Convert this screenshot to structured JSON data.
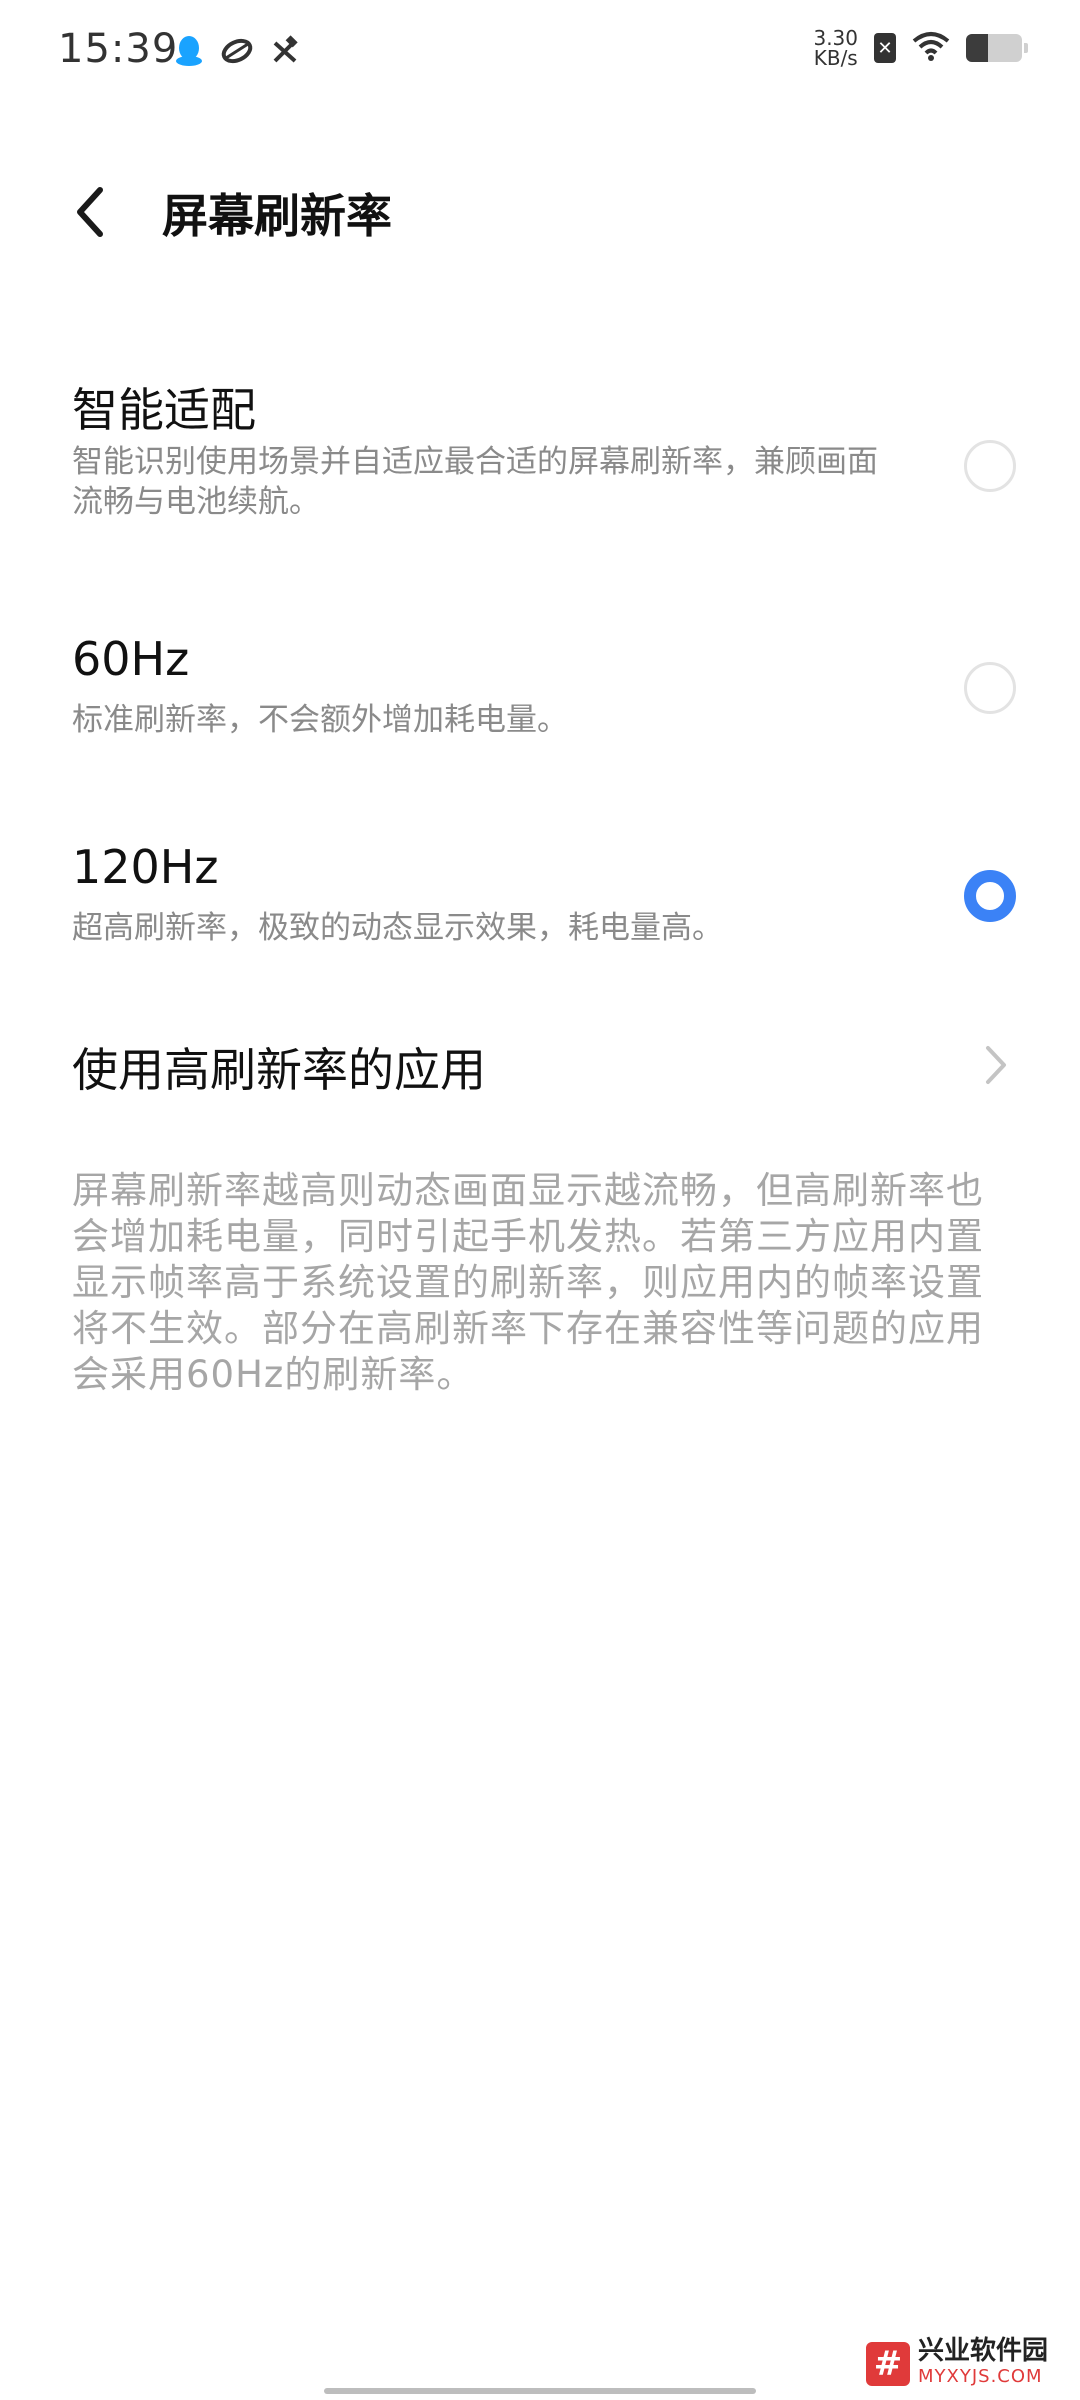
{
  "status_bar": {
    "time": "15:39",
    "net_speed_value": "3.30",
    "net_speed_unit": "KB/s",
    "battery_level": 0.4,
    "left_icons": [
      "qq-icon",
      "bird-icon",
      "tools-icon"
    ],
    "right_icons": [
      "sim-x-icon",
      "wifi-icon",
      "battery-icon"
    ]
  },
  "header": {
    "title": "屏幕刷新率"
  },
  "options": [
    {
      "title": "智能适配",
      "description": "智能识别使用场景并自适应最合适的屏幕刷新率，兼顾画面流畅与电池续航。",
      "selected": false
    },
    {
      "title": "60Hz",
      "description": "标准刷新率，不会额外增加耗电量。",
      "selected": false
    },
    {
      "title": "120Hz",
      "description": "超高刷新率，极致的动态显示效果，耗电量高。",
      "selected": true
    }
  ],
  "high_refresh_apps": {
    "label": "使用高刷新率的应用"
  },
  "info": {
    "text": "屏幕刷新率越高则动态画面显示越流畅，但高刷新率也会增加耗电量，同时引起手机发热。若第三方应用内置显示帧率高于系统设置的刷新率，则应用内的帧率设置将不生效。部分在高刷新率下存在兼容性等问题的应用会采用60Hz的刷新率。"
  },
  "watermark": {
    "logo_char": "#",
    "name": "兴业软件园",
    "domain": "MYXYJS.COM"
  },
  "colors": {
    "accent": "#3b82f6",
    "secondary_text": "#8a8a8a",
    "info_text": "#a6a6a6",
    "watermark_red": "#e03a3a"
  }
}
